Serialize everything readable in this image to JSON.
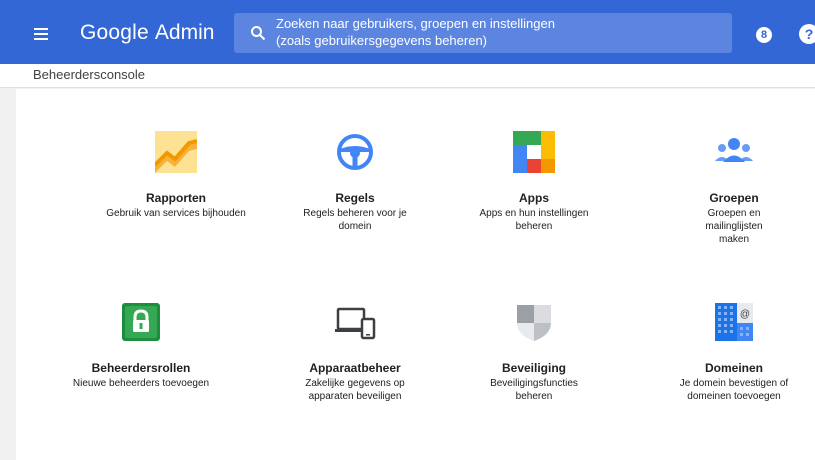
{
  "header": {
    "brand": "Google",
    "product": "Admin",
    "search": {
      "line1": "Zoeken naar gebruikers, groepen en instellingen",
      "line2": "(zoals gebruikersgegevens beheren)"
    },
    "support_glyph": "8",
    "help_glyph": "?"
  },
  "breadcrumb": "Beheerdersconsole",
  "colors": {
    "topbar": "#3367d6",
    "search_bg": "#5b85df"
  },
  "cards": [
    {
      "title": "Rapporten",
      "desc_lines": [
        "Gebruik van services bijhouden"
      ],
      "icon": "reports-icon"
    },
    {
      "title": "Regels",
      "desc_lines": [
        "Regels beheren voor je",
        "domein"
      ],
      "icon": "steering-wheel-icon"
    },
    {
      "title": "Apps",
      "desc_lines": [
        "Apps en hun instellingen",
        "beheren"
      ],
      "icon": "apps-grid-icon"
    },
    {
      "title": "Groepen",
      "desc_lines": [
        "Groepen en",
        "mailinglijsten",
        "maken"
      ],
      "icon": "groups-icon"
    },
    {
      "title": "Beheerdersrollen",
      "desc_lines": [
        "Nieuwe beheerders toevoegen"
      ],
      "icon": "admin-lock-icon"
    },
    {
      "title": "Apparaatbeheer",
      "desc_lines": [
        "Zakelijke gegevens op",
        "apparaten beveiligen"
      ],
      "icon": "devices-icon"
    },
    {
      "title": "Beveiliging",
      "desc_lines": [
        "Beveiligingsfuncties",
        "beheren"
      ],
      "icon": "shield-icon"
    },
    {
      "title": "Domeinen",
      "desc_lines": [
        "Je domein bevestigen of",
        "domeinen toevoegen"
      ],
      "icon": "domains-icon"
    }
  ]
}
